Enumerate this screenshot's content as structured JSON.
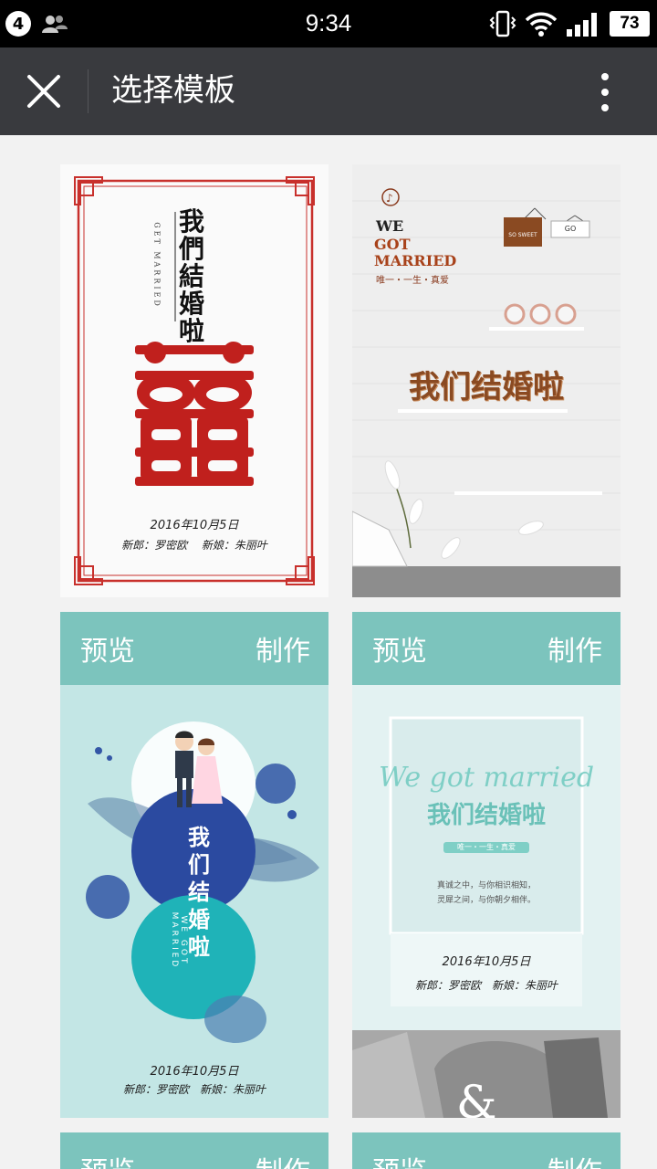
{
  "status_bar": {
    "notification_count": "4",
    "time": "9:34",
    "battery": "73",
    "icons": [
      "users-icon",
      "vibrate-icon",
      "wifi-icon",
      "signal-icon",
      "battery-icon"
    ]
  },
  "app_bar": {
    "title": "选择模板",
    "close_icon": "close-icon",
    "more_icon": "more-vertical-icon",
    "background": "#393a3e"
  },
  "accent_color": "#7cc4bd",
  "templates": [
    {
      "title_vertical": "我們結婚啦",
      "subtitle_vertical": "GET MARRIED",
      "date": "2016年10月5日",
      "couple": "新郎：罗密欧　 新娘：朱丽叶"
    },
    {
      "line1": "WE",
      "line2": "GOT",
      "line3": "MARRIED",
      "tagline": "唯一・一生・真爱",
      "sign1": "SO SWEET",
      "sign2": "GO",
      "title": "我们结婚啦"
    },
    {
      "title_vertical": "我们结婚啦",
      "subtitle_vertical": "WE GOT MARRIED",
      "date": "2016年10月5日",
      "couple": "新郎：罗密欧　新娘：朱丽叶"
    },
    {
      "script_title": "We got married",
      "title": "我们结婚啦",
      "tagline": "唯一・一生・真爱",
      "line1": "真诚之中，与你相识相知，",
      "line2": "灵犀之间，与你朝夕相伴。",
      "date": "2016年10月5日",
      "couple": "新郎：罗密欧　新娘：朱丽叶"
    }
  ],
  "actions": {
    "preview": "预览",
    "make": "制作"
  }
}
